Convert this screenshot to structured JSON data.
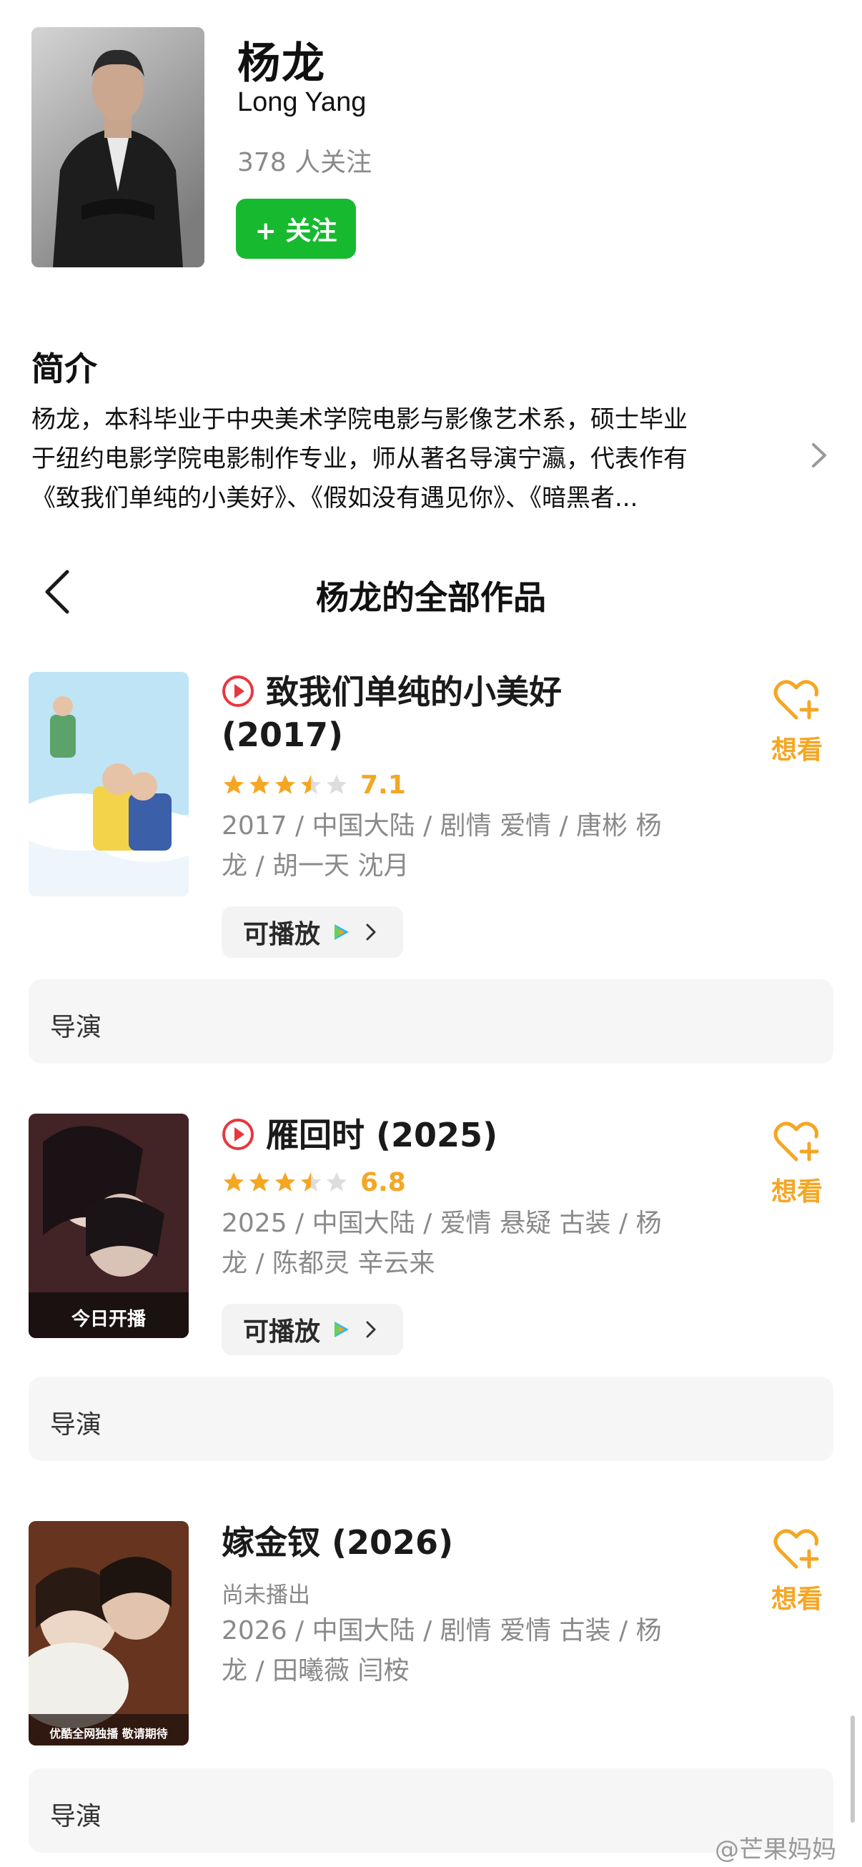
{
  "person": {
    "name_cn": "杨龙",
    "name_en": "Long Yang",
    "followers": "378 人关注",
    "follow_label": "+ 关注"
  },
  "intro": {
    "title": "简介",
    "lines": [
      "杨龙，本科毕业于中央美术学院电影与影像艺术系，硕士毕业",
      "于纽约电影学院电影制作专业，师从著名导演宁瀛，代表作有",
      "《致我们单纯的小美好》、《假如没有遇见你》、《暗黑者..."
    ]
  },
  "works_header": {
    "title": "杨龙的全部作品"
  },
  "works": [
    {
      "title_lines": [
        "致我们单纯的小美好",
        "(2017)"
      ],
      "playable_icon": "play-circle-icon",
      "rating_stars": 3.5,
      "score": "7.1",
      "meta_lines": [
        "2017 / 中国大陆 / 剧情 爱情 / 唐彬 杨",
        "龙 / 胡一天 沈月"
      ],
      "playable_label": "可播放",
      "wish_label": "想看",
      "role": "导演"
    },
    {
      "title_lines": [
        "雁回时 (2025)"
      ],
      "playable_icon": "play-circle-icon",
      "rating_stars": 3.5,
      "score": "6.8",
      "poster_tag": "今日开播",
      "meta_lines": [
        "2025 / 中国大陆 / 爱情 悬疑 古装 / 杨",
        "龙 / 陈都灵 辛云来"
      ],
      "playable_label": "可播放",
      "wish_label": "想看",
      "role": "导演"
    },
    {
      "title_lines": [
        "嫁金钗 (2026)"
      ],
      "status": "尚未播出",
      "poster_tag": "优酷全网独播 敬请期待",
      "meta_lines": [
        "2026 / 中国大陆 / 剧情 爱情 古装 / 杨",
        "龙 / 田曦薇 闫桉"
      ],
      "wish_label": "想看",
      "role": "导演"
    }
  ],
  "watermark": "@芒果妈妈",
  "colors": {
    "follow_green": "#17b92f",
    "accent_orange": "#f5a623",
    "play_red": "#e8373e",
    "meta_gray": "#8a8a8a"
  }
}
